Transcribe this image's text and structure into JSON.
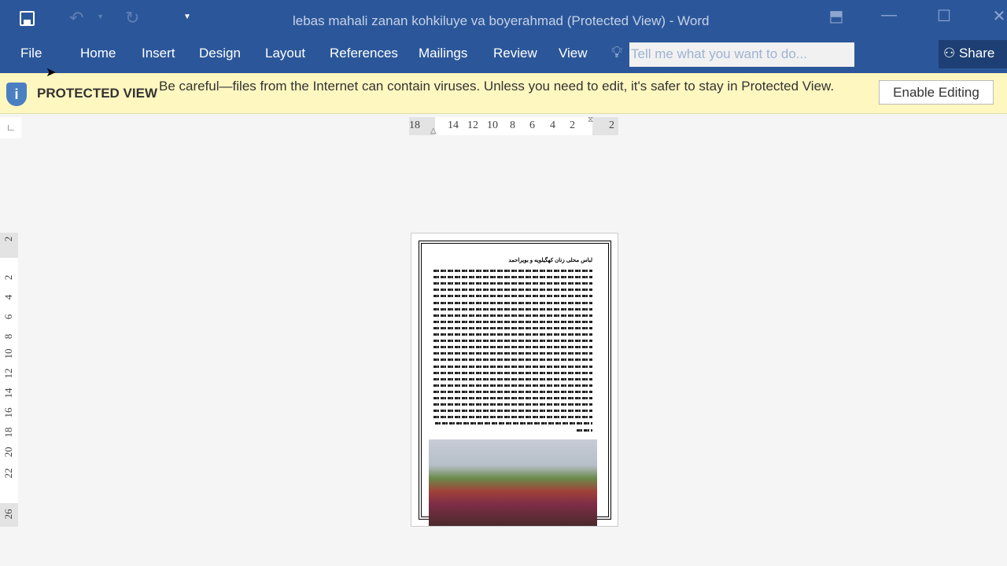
{
  "window": {
    "title": "lebas mahali zanan kohkiluye va boyerahmad (Protected View) - Word"
  },
  "qat": {
    "icons": [
      "save-icon",
      "undo-icon",
      "redo-icon",
      "customize-qat-icon"
    ]
  },
  "tabs": [
    "File",
    "Home",
    "Insert",
    "Design",
    "Layout",
    "References",
    "Mailings",
    "Review",
    "View"
  ],
  "tellme": {
    "placeholder": "Tell me what you want to do..."
  },
  "share": {
    "label": "Share"
  },
  "protected": {
    "label": "PROTECTED VIEW",
    "message": "Be careful—files from the Internet can contain viruses. Unless you need to edit, it's safer to stay in Protected View.",
    "button": "Enable Editing"
  },
  "hruler": [
    "18",
    "14",
    "12",
    "10",
    "8",
    "6",
    "4",
    "2",
    "2"
  ],
  "vruler": [
    "2",
    "2",
    "4",
    "6",
    "8",
    "10",
    "12",
    "14",
    "16",
    "18",
    "20",
    "22",
    "26"
  ],
  "document": {
    "title": "لباس محلی زنان کهگیلویه و بویراحمد"
  }
}
